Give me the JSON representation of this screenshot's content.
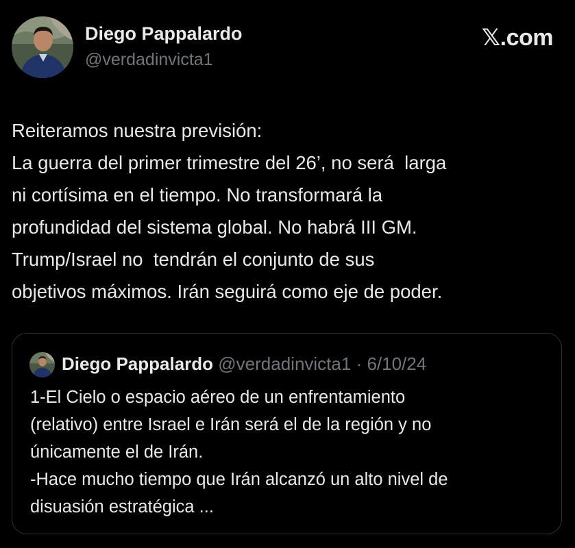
{
  "author": {
    "name": "Diego Pappalardo",
    "handle": "@verdadinvicta1"
  },
  "brand": {
    "logo_text": "𝕏.com"
  },
  "tweet": {
    "lines": [
      "Reiteramos nuestra previsión:",
      "La guerra del primer trimestre del 26’, no será  larga",
      "ni cortísima en el tiempo. No transformará la",
      "profundidad del sistema global. No habrá III GM.",
      "Trump/Israel no  tendrán el conjunto de sus",
      "objetivos máximos. Irán seguirá como eje de poder."
    ]
  },
  "quoted_tweet": {
    "author_name": "Diego Pappalardo",
    "handle": "@verdadinvicta1",
    "separator": " · ",
    "date": "6/10/24",
    "lines": [
      "1-El Cielo o espacio aéreo de un enfrentamiento",
      "(relativo) entre Israel e Irán será el de la región y no",
      "únicamente el de Irán.",
      "-Hace mucho tiempo que Irán alcanzó un alto nivel de",
      "disuasión estratégica ..."
    ]
  },
  "colors": {
    "background": "#000000",
    "primary_text": "#e7e9ea",
    "secondary_text": "#71767b",
    "border": "#2f3336"
  }
}
